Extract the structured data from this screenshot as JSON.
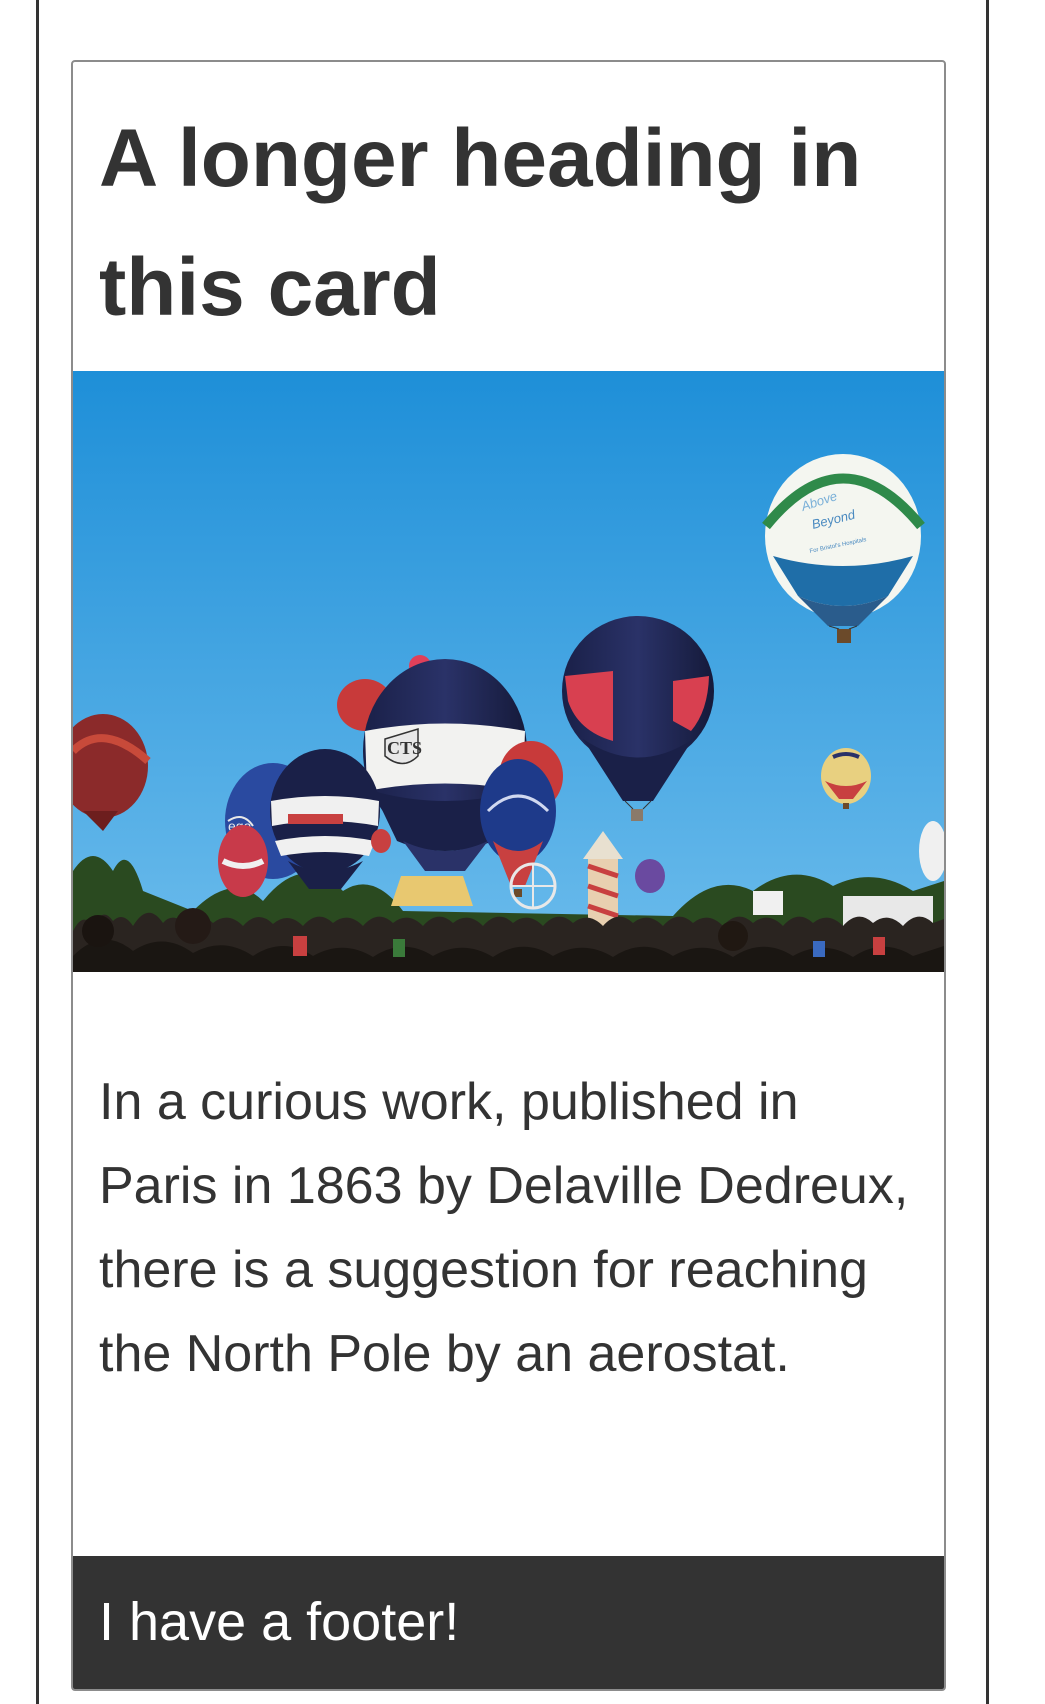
{
  "card": {
    "heading": "A longer heading in this card",
    "image_alt": "Hot air balloons over a crowd at a festival",
    "body": "In a curious work, published in Paris in 1863 by Delaville Dedreux, there is a suggestion for reaching the North Pole by an aerostat.",
    "footer": "I have a footer!"
  },
  "image_text": {
    "balloon_brand_1": "Above",
    "balloon_brand_2": "Beyond",
    "balloon_sub": "For Bristol's Hospitals",
    "balloon_cts": "CTS",
    "balloon_left": "ega"
  },
  "colors": {
    "text": "#333333",
    "footer_bg": "#333333",
    "footer_text": "#ffffff",
    "card_border": "#8c8c8c",
    "sky_top": "#1e8fd8",
    "sky_bottom": "#67b9ec"
  }
}
